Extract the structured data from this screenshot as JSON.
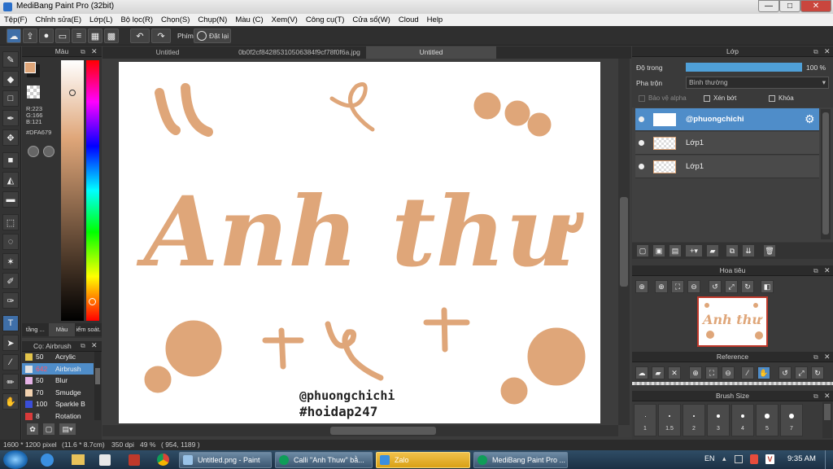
{
  "window": {
    "title": "MediBang Paint Pro (32bit)",
    "min": "—",
    "max": "□",
    "close": "✕"
  },
  "menu": [
    "Tệp(F)",
    "Chỉnh sửa(E)",
    "Lớp(L)",
    "Bộ lọc(R)",
    "Chọn(S)",
    "Chụp(N)",
    "Màu (C)",
    "Xem(V)",
    "Công cụ(T)",
    "Cửa sổ(W)",
    "Cloud",
    "Help"
  ],
  "toolbar": {
    "keys_label": "Phím",
    "reset_label": "Đặt lại"
  },
  "color_panel": {
    "title": "Màu",
    "r": "R:223",
    "g": "G:166",
    "b": "B:121",
    "hex": "#DFA679",
    "tabs": [
      "tầng ...",
      "Màu",
      "iểm soát."
    ],
    "foreground": "#DFA679"
  },
  "brush_panel": {
    "title": "Cọ: Airbrush",
    "items": [
      {
        "size": "50",
        "name": "Acrylic",
        "color": "#e3c44a",
        "selected": false
      },
      {
        "size": "642",
        "name": "Airbrush",
        "color": "#e3e3e3",
        "selected": true
      },
      {
        "size": "50",
        "name": "Blur",
        "color": "#e6b3e6",
        "selected": false
      },
      {
        "size": "70",
        "name": "Smudge",
        "color": "#f2d2b0",
        "selected": false
      },
      {
        "size": "100",
        "name": "Sparkle B",
        "color": "#3a4ed8",
        "selected": false
      },
      {
        "size": "8",
        "name": "Rotation",
        "color": "#d83a3a",
        "selected": false
      }
    ]
  },
  "doc_tabs": [
    "Untitled",
    "0b0f2cf84285310506384f9cf78f0f6a.jpg",
    "Untitled"
  ],
  "artwork": {
    "title_text": "Anh thư",
    "caption1": "@phuongchichi",
    "caption2": "#hoidap247",
    "ink": "#DFA679"
  },
  "layer_panel": {
    "title": "Lớp",
    "opacity_label": "Độ trong",
    "opacity_value": "100 %",
    "blend_label": "Pha trộn",
    "blend_value": "Bình thường",
    "protect_alpha": "Bảo vệ alpha",
    "clipping": "Xén bớt",
    "lock": "Khóa",
    "layers": [
      {
        "name": "@phuongchichi",
        "selected": true
      },
      {
        "name": "Lớp1",
        "selected": false
      },
      {
        "name": "Lớp1",
        "selected": false
      }
    ]
  },
  "navigator": {
    "title": "Hoa tiêu"
  },
  "reference": {
    "title": "Reference"
  },
  "brush_size": {
    "title": "Brush Size",
    "sizes": [
      "1",
      "1.5",
      "2",
      "3",
      "4",
      "5",
      "7"
    ]
  },
  "status": {
    "size": "1600 * 1200 pixel",
    "cm": "(11.6 * 8.7cm)",
    "dpi": "350 dpi",
    "zoom": "49 %",
    "coords": "( 954, 1189 )"
  },
  "taskbar": {
    "tasks": [
      "Untitled.png - Paint",
      "Calli \"Anh Thuw\" bằ...",
      "Zalo",
      "MediBang Paint Pro ..."
    ],
    "lang": "EN",
    "time": "9:35 AM"
  }
}
